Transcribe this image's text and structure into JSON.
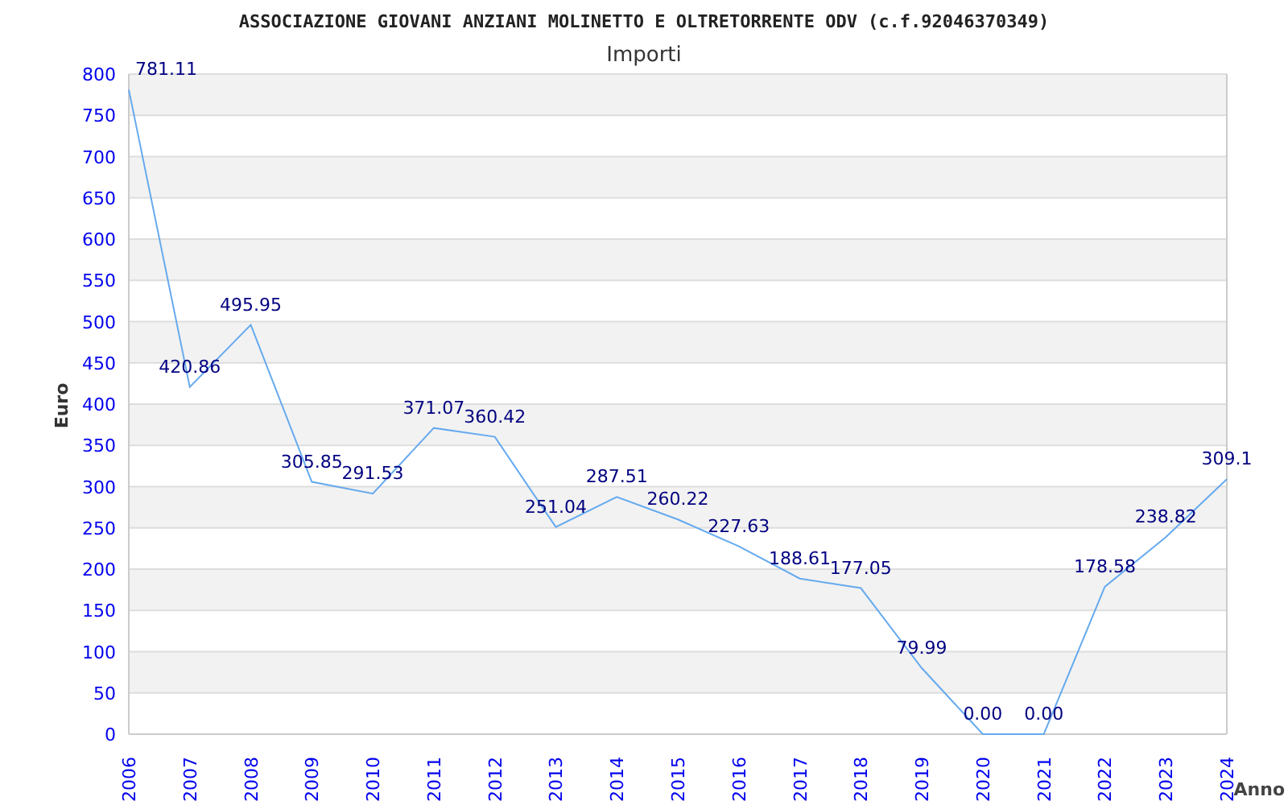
{
  "header": "ASSOCIAZIONE GIOVANI ANZIANI MOLINETTO E OLTRETORRENTE ODV (c.f.92046370349)",
  "chart_data": {
    "type": "line",
    "title": "Importi",
    "xlabel": "Anno",
    "ylabel": "Euro",
    "categories": [
      "2006",
      "2007",
      "2008",
      "2009",
      "2010",
      "2011",
      "2012",
      "2013",
      "2014",
      "2015",
      "2016",
      "2017",
      "2018",
      "2019",
      "2020",
      "2021",
      "2022",
      "2023",
      "2024"
    ],
    "series": [
      {
        "color": "#66aaee",
        "values": [
          781.11,
          420.86,
          495.95,
          305.85,
          291.53,
          371.07,
          360.42,
          251.04,
          287.51,
          260.22,
          227.63,
          188.61,
          177.05,
          79.99,
          0,
          0,
          178.58,
          238.82,
          309.1
        ]
      }
    ],
    "value_labels": [
      "781.11",
      "420.86",
      "495.95",
      "305.85",
      "291.53",
      "371.07",
      "360.42",
      "251.04",
      "287.51",
      "260.22",
      "227.63",
      "188.61",
      "177.05",
      "79.99",
      "0.00",
      "0.00",
      "178.58",
      "238.82",
      "309.1"
    ],
    "ylim": [
      0,
      800
    ],
    "grid": true,
    "yticks": [
      0,
      50,
      100,
      150,
      200,
      250,
      300,
      350,
      400,
      450,
      500,
      550,
      600,
      650,
      700,
      750,
      800
    ]
  }
}
